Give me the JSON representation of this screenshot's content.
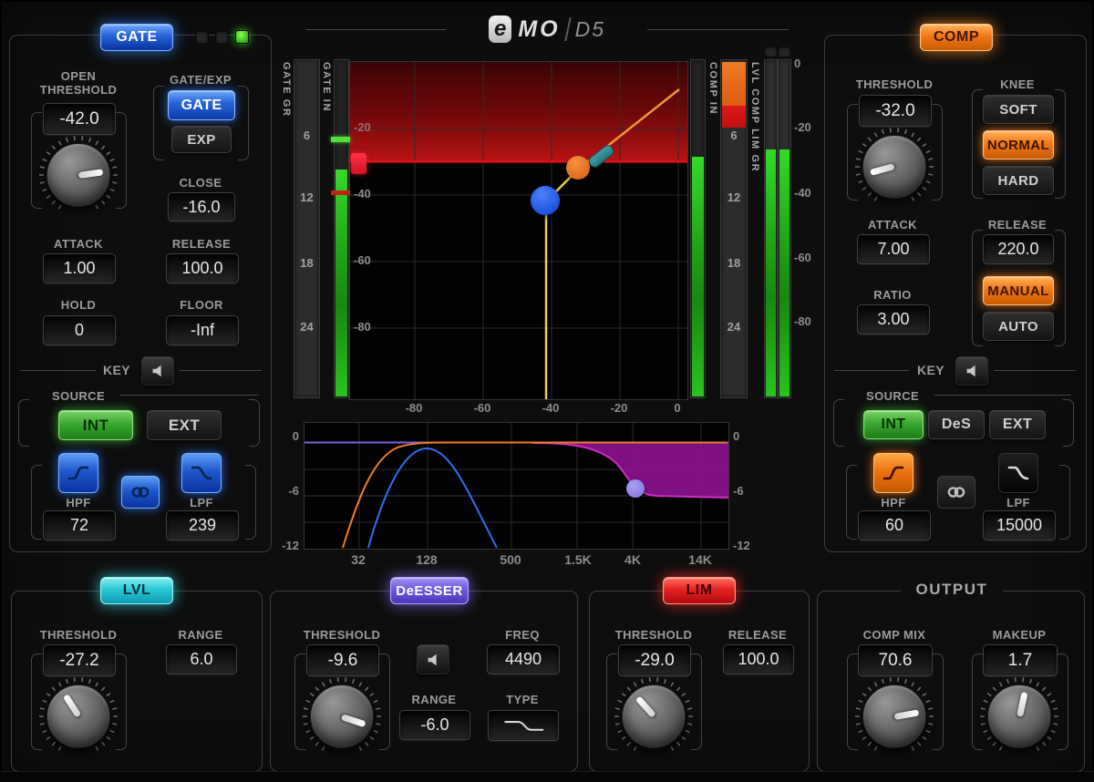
{
  "brand": {
    "logo_e": "e",
    "logo_rest": "MO",
    "model": "D5"
  },
  "colors": {
    "gate_blue": "#2e7fe8",
    "comp_orange": "#f07818",
    "lvl_cyan": "#2fd4dc",
    "deesser_purple": "#7b68e8",
    "lim_red": "#e42222",
    "source_green": "#46b33c",
    "meter_green": "#2cc41e",
    "gr_orange": "#e2611c",
    "gr_red": "#d41818",
    "curve_yellow": "#e9d34b",
    "curve_orange": "#f29a38",
    "handle_blue": "#1f5df0",
    "handle_orange": "#ef7120",
    "handle_teal": "#33909a",
    "handle_purple": "#9183ea",
    "limit_zone_red": "#a81114"
  },
  "gate": {
    "section_label": "GATE",
    "open_threshold_label": "OPEN THRESHOLD",
    "open_threshold_value": "-42.0",
    "open_threshold_angle": 82,
    "mode_label": "GATE/EXP",
    "mode_options": {
      "gate": "GATE",
      "exp": "EXP"
    },
    "close_label": "CLOSE",
    "close_value": "-16.0",
    "attack_label": "ATTACK",
    "attack_value": "1.00",
    "release_label": "RELEASE",
    "release_value": "100.0",
    "hold_label": "HOLD",
    "hold_value": "0",
    "floor_label": "FLOOR",
    "floor_value": "-Inf",
    "key_label": "KEY",
    "source_label": "SOURCE",
    "source_options": {
      "int": "INT",
      "ext": "EXT"
    },
    "hpf_label": "HPF",
    "hpf_value": "72",
    "lpf_label": "LPF",
    "lpf_value": "239"
  },
  "comp": {
    "section_label": "COMP",
    "threshold_label": "THRESHOLD",
    "threshold_value": "-32.0",
    "threshold_angle": -105,
    "knee_label": "KNEE",
    "knee_options": {
      "soft": "SOFT",
      "normal": "NORMAL",
      "hard": "HARD"
    },
    "attack_label": "ATTACK",
    "attack_value": "7.00",
    "release_label": "RELEASE",
    "release_value": "220.0",
    "release_mode_options": {
      "manual": "MANUAL",
      "auto": "AUTO"
    },
    "ratio_label": "RATIO",
    "ratio_value": "3.00",
    "key_label": "KEY",
    "source_label": "SOURCE",
    "source_options": {
      "int": "INT",
      "des": "DeS",
      "ext": "EXT"
    },
    "hpf_label": "HPF",
    "hpf_value": "60",
    "lpf_label": "LPF",
    "lpf_value": "15000"
  },
  "meters": {
    "gate_gr_label": "GATE GR",
    "gate_in_label": "GATE IN",
    "comp_in_label": "COMP IN",
    "lvl_comp_lim_gr_label": "LVL COMP LIM GR",
    "gr_scale": [
      "6",
      "12",
      "18",
      "24"
    ],
    "output_scale": [
      "0",
      "-20",
      "-40",
      "-60",
      "-80"
    ]
  },
  "transfer_graph": {
    "x_ticks": [
      "-80",
      "-60",
      "-40",
      "-20",
      "0"
    ],
    "y_ticks": [
      "-20",
      "-40",
      "-60",
      "-80"
    ]
  },
  "eq_graph": {
    "y_ticks": [
      "0",
      "-6",
      "-12"
    ],
    "x_ticks": [
      "32",
      "128",
      "500",
      "1.5K",
      "4K",
      "14K"
    ]
  },
  "lvl": {
    "section_label": "LVL",
    "threshold_label": "THRESHOLD",
    "threshold_value": "-27.2",
    "threshold_angle": -33,
    "range_label": "RANGE",
    "range_value": "6.0"
  },
  "deesser": {
    "section_label": "DeESSER",
    "threshold_label": "THRESHOLD",
    "threshold_value": "-9.6",
    "threshold_angle": 108,
    "freq_label": "FREQ",
    "freq_value": "4490",
    "range_label": "RANGE",
    "range_value": "-6.0",
    "type_label": "TYPE"
  },
  "lim": {
    "section_label": "LIM",
    "threshold_label": "THRESHOLD",
    "threshold_value": "-29.0",
    "threshold_angle": -42,
    "release_label": "RELEASE",
    "release_value": "100.0"
  },
  "output": {
    "section_label": "OUTPUT",
    "comp_mix_label": "COMP MIX",
    "comp_mix_value": "70.6",
    "comp_mix_angle": 80,
    "makeup_label": "MAKEUP",
    "makeup_value": "1.7",
    "makeup_angle": 12
  }
}
